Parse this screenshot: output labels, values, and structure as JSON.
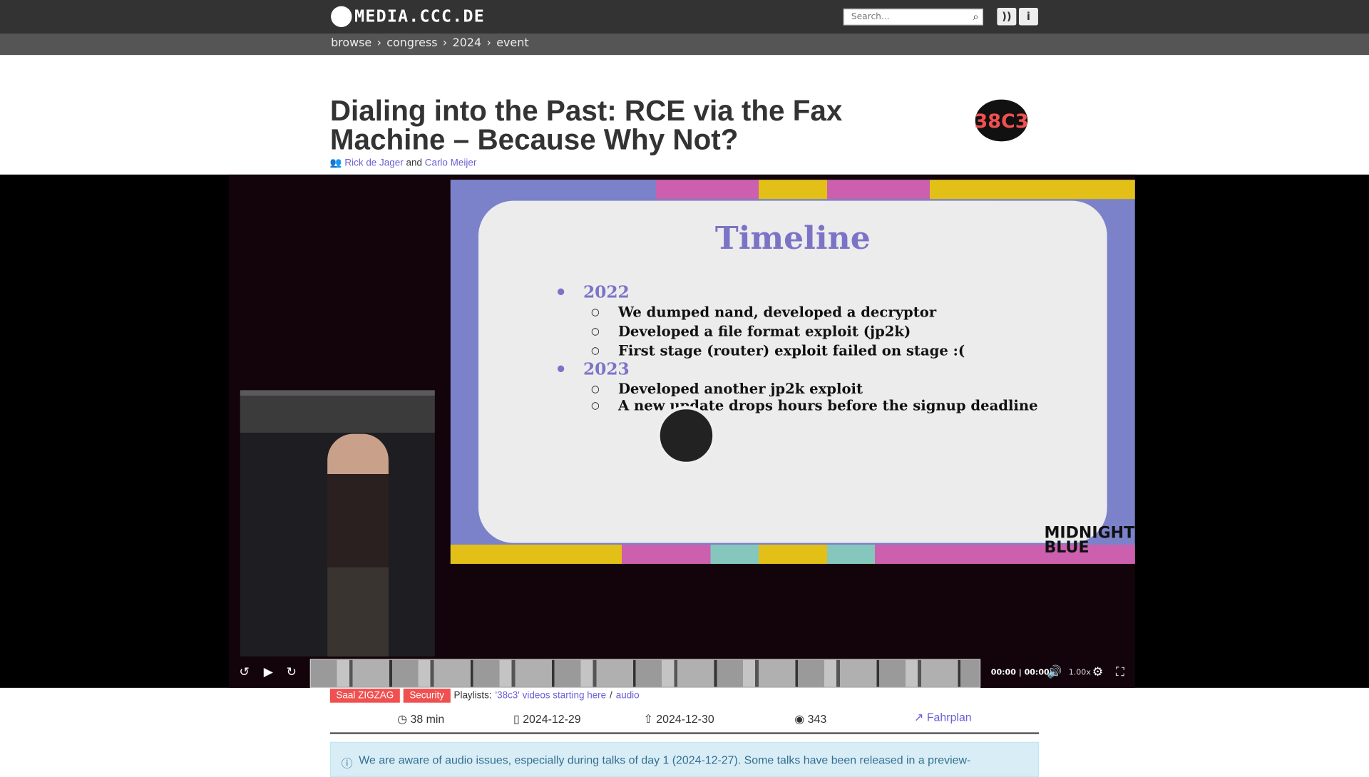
{
  "header": {
    "logo_text": "MEDIA.CCC.DE",
    "search_placeholder": "Search...",
    "rss": "rss-icon",
    "info": "i"
  },
  "breadcrumb": [
    "browse",
    "congress",
    "2024",
    "event"
  ],
  "title": "Dialing into the Past: RCE via the Fax Machine – Because Why Not?",
  "authors": {
    "a1": "Rick de Jager",
    "and": "and",
    "a2": "Carlo Meijer"
  },
  "event_logo": "38C3 Illegal Instructions",
  "slide": {
    "title": "Timeline",
    "y1": "2022",
    "y1_items": [
      "We dumped nand, developed a decryptor",
      "Developed a file format exploit (jp2k)",
      "First stage (router) exploit failed on stage :("
    ],
    "y2": "2023",
    "y2_items": [
      "Developed another jp2k exploit",
      "A new update drops hours before the signup deadline"
    ],
    "brand": "MIDNIGHT BLUE"
  },
  "player": {
    "time": "00:00 | 00:00",
    "rate": "1.00x",
    "progress": 0
  },
  "tags": [
    "Saal ZIGZAG",
    "Security"
  ],
  "playlists": {
    "label": "Playlists:",
    "p1": "'38c3' videos starting here",
    "sep": "/",
    "p2": "audio"
  },
  "meta": {
    "duration": "38 min",
    "date": "2024-12-29",
    "released": "2024-12-30",
    "views": "343",
    "fahrplan": "Fahrplan"
  },
  "alert": "We are aware of audio issues, especially during talks of day 1 (2024-12-27). Some talks have been released in a preview-"
}
